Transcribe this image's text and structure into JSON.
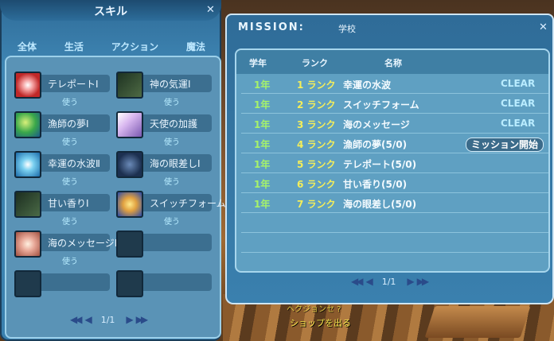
{
  "skill_window": {
    "title": "スキル",
    "close": "✕",
    "tabs": [
      "全体",
      "生活",
      "アクション",
      "魔法"
    ],
    "skills": [
      {
        "name": "テレポートⅠ",
        "use": "使う",
        "icon": "teleport-icon",
        "color": "#e04848"
      },
      {
        "name": "神の気運Ⅰ",
        "use": "使う",
        "icon": "divine-luck-icon",
        "color": "#2a4a2e"
      },
      {
        "name": "漁師の夢Ⅰ",
        "use": "使う",
        "icon": "fisher-dream-icon",
        "color": "#3aa84a"
      },
      {
        "name": "天使の加護",
        "use": "使う",
        "icon": "angel-blessing-icon",
        "color": "#b890d8"
      },
      {
        "name": "幸運の水波Ⅱ",
        "use": "使う",
        "icon": "lucky-wave-icon",
        "color": "#58a8e0"
      },
      {
        "name": "海の眼差しⅠ",
        "use": "使う",
        "icon": "sea-gaze-icon",
        "color": "#1c3050"
      },
      {
        "name": "甘い香りⅠ",
        "use": "使う",
        "icon": "sweet-scent-icon",
        "color": "#2f4a34"
      },
      {
        "name": "スイッチフォームⅡ",
        "use": "使う",
        "icon": "switch-form-icon",
        "color": "#e0a040"
      },
      {
        "name": "海のメッセージⅡ",
        "use": "使う",
        "icon": "sea-message-icon",
        "color": "#d88878"
      }
    ],
    "pager": {
      "prev": "◀◀  ◀",
      "page": "1/1",
      "next": "▶  ▶▶"
    }
  },
  "mission_window": {
    "title": "MISSION:",
    "subtitle": "学校",
    "close": "✕",
    "columns": {
      "grade": "学年",
      "rank": "ランク",
      "name": "名称"
    },
    "rows": [
      {
        "grade": "1年",
        "rank": "1 ランク",
        "name": "幸運の水波",
        "status": "CLEAR"
      },
      {
        "grade": "1年",
        "rank": "2 ランク",
        "name": "スイッチフォーム",
        "status": "CLEAR"
      },
      {
        "grade": "1年",
        "rank": "3 ランク",
        "name": "海のメッセージ",
        "status": "CLEAR"
      },
      {
        "grade": "1年",
        "rank": "4 ランク",
        "name": "漁師の夢(5/0)",
        "button": "ミッション開始"
      },
      {
        "grade": "1年",
        "rank": "5 ランク",
        "name": "テレポート(5/0)"
      },
      {
        "grade": "1年",
        "rank": "6 ランク",
        "name": "甘い香り(5/0)"
      },
      {
        "grade": "1年",
        "rank": "7 ランク",
        "name": "海の眼差し(5/0)"
      }
    ],
    "pager": {
      "page": "1/1"
    }
  },
  "background": {
    "line1": "ヘクジョンセ ?",
    "line2": "ショップを出る"
  }
}
